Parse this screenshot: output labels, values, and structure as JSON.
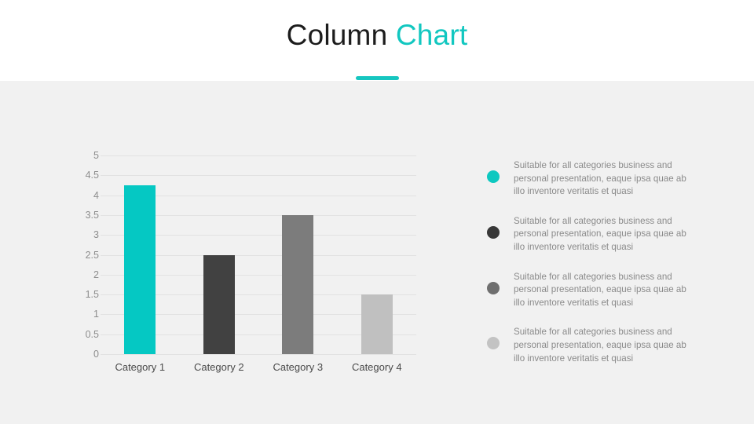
{
  "header": {
    "title_part1": "Column ",
    "title_part2": "Chart",
    "accent_color": "#12c7c0"
  },
  "chart_data": {
    "type": "bar",
    "title": "Column Chart",
    "xlabel": "",
    "ylabel": "",
    "categories": [
      "Category 1",
      "Category 2",
      "Category 3",
      "Category 4"
    ],
    "values": [
      4.25,
      2.5,
      3.5,
      1.5
    ],
    "bar_colors": [
      "#05c8c3",
      "#414141",
      "#7c7c7c",
      "#c0c0c0"
    ],
    "ylim": [
      0,
      5
    ],
    "ytick_labels": [
      "5",
      "4.5",
      "4",
      "3.5",
      "3",
      "2.5",
      "2",
      "1.5",
      "1",
      "0.5",
      "0"
    ],
    "ytick_values": [
      5,
      4.5,
      4,
      3.5,
      3,
      2.5,
      2,
      1.5,
      1,
      0.5,
      0
    ],
    "grid": true,
    "legend_position": "right"
  },
  "legend": {
    "items": [
      {
        "color": "#0dc8c0",
        "text": "Suitable for all categories business and personal presentation, eaque ipsa quae ab illo inventore veritatis et quasi"
      },
      {
        "color": "#383838",
        "text": "Suitable for all categories business and personal presentation, eaque ipsa quae ab illo inventore veritatis et quasi"
      },
      {
        "color": "#6f6f6f",
        "text": "Suitable for all categories business and personal presentation, eaque ipsa quae ab illo inventore veritatis et quasi"
      },
      {
        "color": "#c3c3c3",
        "text": "Suitable for all categories business and personal presentation, eaque ipsa quae ab illo inventore veritatis et quasi"
      }
    ]
  }
}
